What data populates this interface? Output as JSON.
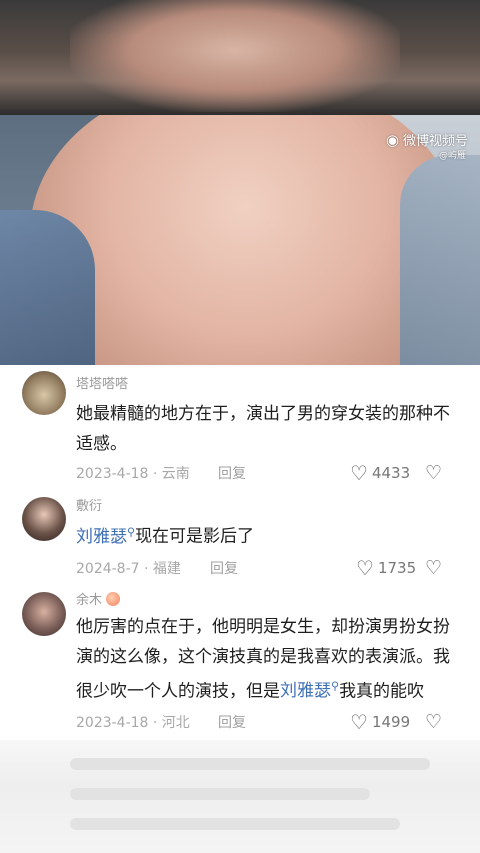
{
  "watermark": {
    "brand": "微博视频号",
    "account": "@屿雁",
    "icon": "weibo-eye-icon"
  },
  "comments": [
    {
      "username": "塔塔嗒嗒",
      "avatar": "cat-avatar",
      "text": "她最精髓的地方在于，演出了男的穿女装的那种不适感。",
      "date": "2023-4-18 · 云南",
      "reply": "回复",
      "likes": "4433"
    },
    {
      "username": "敷衍",
      "avatar": "girl-avatar",
      "mention": "刘雅瑟",
      "text_after_mention": "现在可是影后了",
      "date": "2024-8-7 · 福建",
      "reply": "回复",
      "likes": "1735"
    },
    {
      "username": "余木",
      "avatar": "girl-avatar-2",
      "badge": "peach-emoji",
      "text_before_mention": "他厉害的点在于，他明明是女生，却扮演男扮女扮演的这么像，这个演技真的是我喜欢的表演派。我很少吹一个人的演技，但是",
      "mention": "刘雅瑟",
      "text_after_mention": "我真的能吹",
      "date": "2023-4-18 · 河北",
      "reply": "回复",
      "likes": "1499"
    }
  ],
  "mention_icon": "search-icon",
  "colors": {
    "mention": "#3d6fb6",
    "meta": "#a8a8a8",
    "text": "#1e1e1e"
  }
}
